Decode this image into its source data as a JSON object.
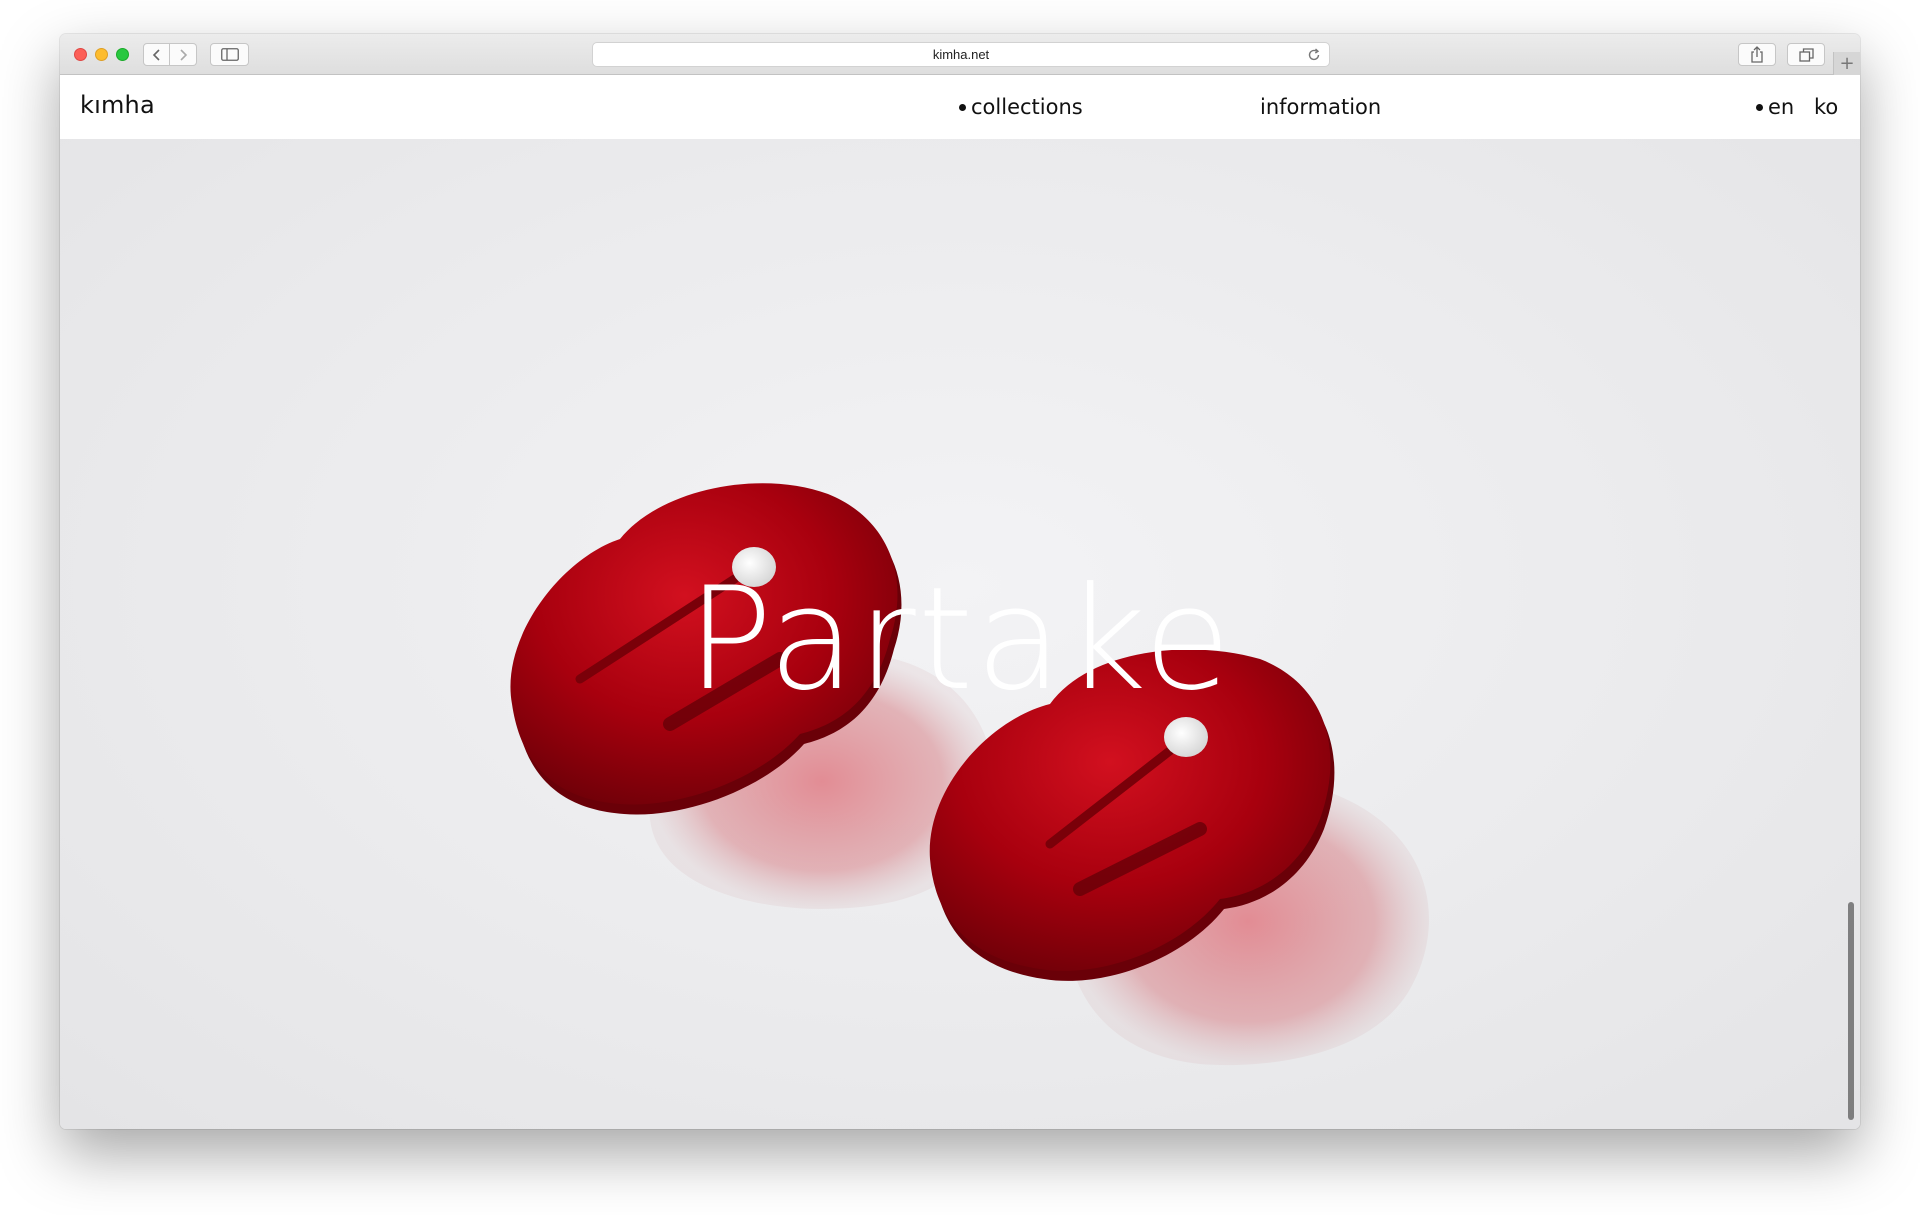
{
  "browser": {
    "url": "kimha.net",
    "icons": [
      "back-icon",
      "forward-icon",
      "sidebar-icon",
      "reload-icon",
      "share-icon",
      "tabs-icon",
      "plus-icon"
    ],
    "new_tab_label": "+"
  },
  "site": {
    "logo": "kımha",
    "nav": {
      "collections": "collections",
      "information": "information"
    },
    "lang": {
      "en": "en",
      "ko": "ko"
    }
  },
  "hero": {
    "title": "Partake",
    "image": "red acrylic earrings on light grey background",
    "colors": {
      "earring": "#b0000f",
      "background": "#ececee"
    }
  }
}
